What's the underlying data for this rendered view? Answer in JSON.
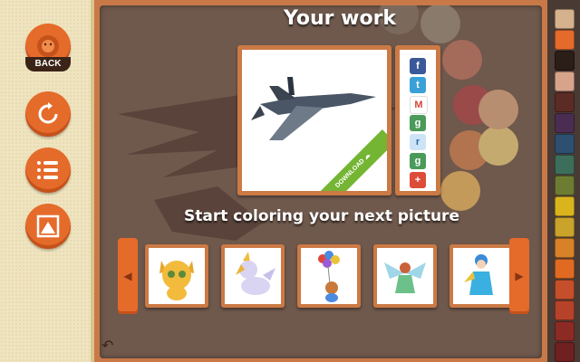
{
  "header": {
    "title": "Your work"
  },
  "sidebar": {
    "back_label": "BACK"
  },
  "preview": {
    "download_label": "DOWNLOAD"
  },
  "share": {
    "buttons": [
      "facebook-icon",
      "twitter-icon",
      "gmail-icon",
      "google-plus-icon",
      "reddit-icon",
      "google-icon",
      "add-icon"
    ]
  },
  "gallery": {
    "heading": "Start coloring your next picture",
    "pictures": [
      "cat",
      "unicorn",
      "bear-balloons",
      "fairy",
      "girl-winter"
    ]
  },
  "colors": {
    "accent": "#e56b2b",
    "frame": "#cc7a45",
    "board": "#6f584c"
  },
  "palette": [
    "#d5b28d",
    "#e56b2b",
    "#2b1d18",
    "#d7a48b",
    "#5b2c25",
    "#4a2d50",
    "#2d4f70",
    "#3d6e5c",
    "#6d7c33",
    "#d9b41d",
    "#c9a32a",
    "#d78128",
    "#e06a21",
    "#c54f2a",
    "#b6422a",
    "#8c2a24",
    "#6f2020"
  ]
}
